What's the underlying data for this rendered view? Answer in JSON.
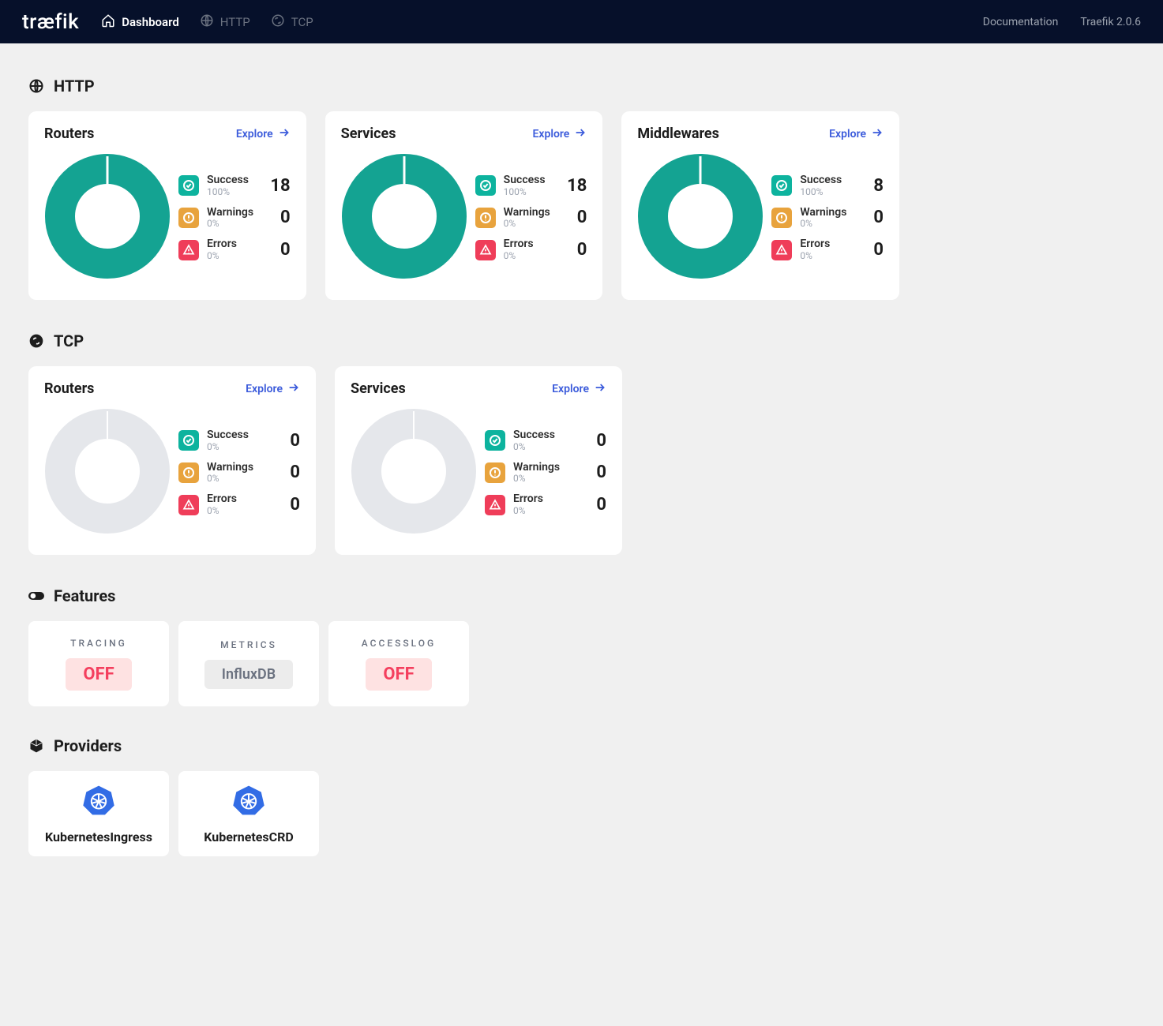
{
  "nav": {
    "logo": "træfik",
    "items": [
      {
        "label": "Dashboard",
        "active": true
      },
      {
        "label": "HTTP",
        "active": false
      },
      {
        "label": "TCP",
        "active": false
      }
    ],
    "docs": "Documentation",
    "version": "Traefik 2.0.6"
  },
  "sections": {
    "http": {
      "title": "HTTP",
      "cards": [
        {
          "title": "Routers",
          "explore": "Explore",
          "stats": {
            "success": {
              "label": "Success",
              "pct": "100%",
              "value": "18"
            },
            "warnings": {
              "label": "Warnings",
              "pct": "0%",
              "value": "0"
            },
            "errors": {
              "label": "Errors",
              "pct": "0%",
              "value": "0"
            }
          },
          "donut_pct": 100
        },
        {
          "title": "Services",
          "explore": "Explore",
          "stats": {
            "success": {
              "label": "Success",
              "pct": "100%",
              "value": "18"
            },
            "warnings": {
              "label": "Warnings",
              "pct": "0%",
              "value": "0"
            },
            "errors": {
              "label": "Errors",
              "pct": "0%",
              "value": "0"
            }
          },
          "donut_pct": 100
        },
        {
          "title": "Middlewares",
          "explore": "Explore",
          "stats": {
            "success": {
              "label": "Success",
              "pct": "100%",
              "value": "8"
            },
            "warnings": {
              "label": "Warnings",
              "pct": "0%",
              "value": "0"
            },
            "errors": {
              "label": "Errors",
              "pct": "0%",
              "value": "0"
            }
          },
          "donut_pct": 100
        }
      ]
    },
    "tcp": {
      "title": "TCP",
      "cards": [
        {
          "title": "Routers",
          "explore": "Explore",
          "stats": {
            "success": {
              "label": "Success",
              "pct": "0%",
              "value": "0"
            },
            "warnings": {
              "label": "Warnings",
              "pct": "0%",
              "value": "0"
            },
            "errors": {
              "label": "Errors",
              "pct": "0%",
              "value": "0"
            }
          },
          "donut_pct": 0
        },
        {
          "title": "Services",
          "explore": "Explore",
          "stats": {
            "success": {
              "label": "Success",
              "pct": "0%",
              "value": "0"
            },
            "warnings": {
              "label": "Warnings",
              "pct": "0%",
              "value": "0"
            },
            "errors": {
              "label": "Errors",
              "pct": "0%",
              "value": "0"
            }
          },
          "donut_pct": 0
        }
      ]
    },
    "features": {
      "title": "Features",
      "items": [
        {
          "label": "TRACING",
          "value": "OFF",
          "style": "off"
        },
        {
          "label": "METRICS",
          "value": "InfluxDB",
          "style": "info"
        },
        {
          "label": "ACCESSLOG",
          "value": "OFF",
          "style": "off"
        }
      ]
    },
    "providers": {
      "title": "Providers",
      "items": [
        {
          "name": "KubernetesIngress"
        },
        {
          "name": "KubernetesCRD"
        }
      ]
    }
  },
  "colors": {
    "teal": "#14a392",
    "grey_donut": "#e5e7eb",
    "warning": "#e8a33d",
    "error": "#ef3d59",
    "link": "#3b5bdb"
  },
  "chart_data": [
    {
      "type": "pie",
      "title": "HTTP Routers",
      "categories": [
        "Success",
        "Warnings",
        "Errors"
      ],
      "values": [
        18,
        0,
        0
      ]
    },
    {
      "type": "pie",
      "title": "HTTP Services",
      "categories": [
        "Success",
        "Warnings",
        "Errors"
      ],
      "values": [
        18,
        0,
        0
      ]
    },
    {
      "type": "pie",
      "title": "HTTP Middlewares",
      "categories": [
        "Success",
        "Warnings",
        "Errors"
      ],
      "values": [
        8,
        0,
        0
      ]
    },
    {
      "type": "pie",
      "title": "TCP Routers",
      "categories": [
        "Success",
        "Warnings",
        "Errors"
      ],
      "values": [
        0,
        0,
        0
      ]
    },
    {
      "type": "pie",
      "title": "TCP Services",
      "categories": [
        "Success",
        "Warnings",
        "Errors"
      ],
      "values": [
        0,
        0,
        0
      ]
    }
  ]
}
